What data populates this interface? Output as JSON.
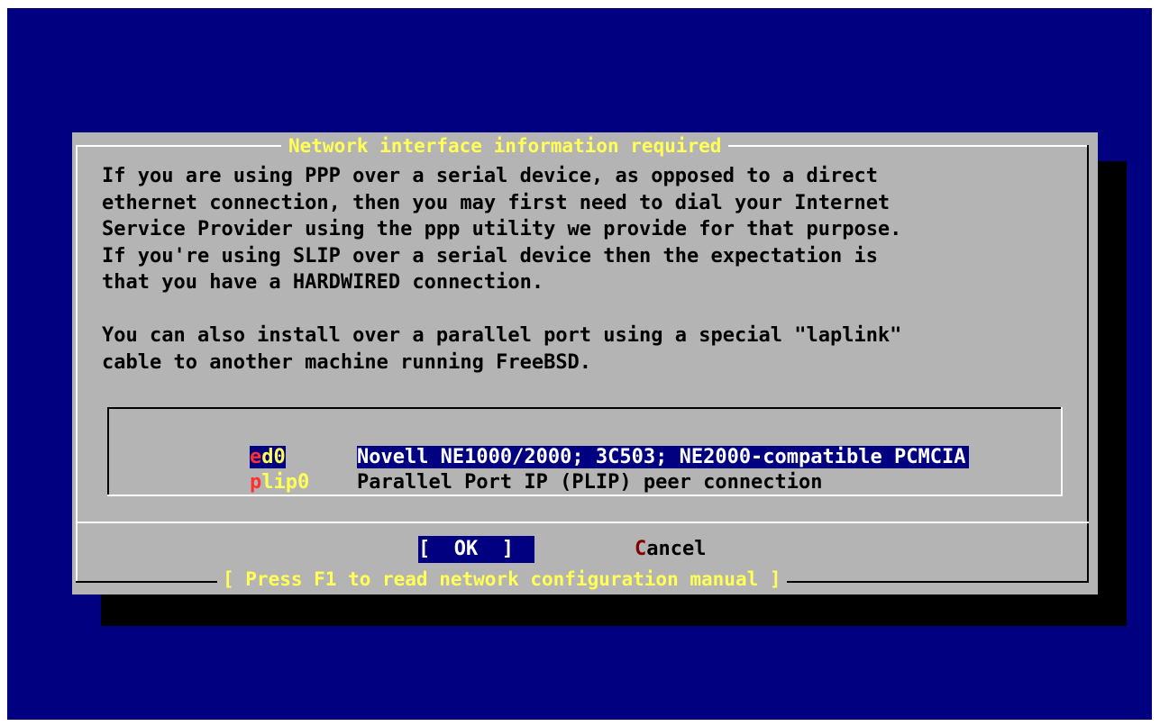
{
  "dialog": {
    "title": "Network interface information required",
    "body": "If you are using PPP over a serial device, as opposed to a direct\nethernet connection, then you may first need to dial your Internet\nService Provider using the ppp utility we provide for that purpose.\nIf you're using SLIP over a serial device then the expectation is\nthat you have a HARDWIRED connection.\n\nYou can also install over a parallel port using a special \"laplink\"\ncable to another machine running FreeBSD.",
    "interfaces": [
      {
        "hot": "e",
        "tag_rest": "d0",
        "description": "Novell NE1000/2000; 3C503; NE2000-compatible PCMCIA",
        "selected": true
      },
      {
        "hot": "p",
        "tag_rest": "lip0",
        "description": "Parallel Port IP (PLIP) peer connection",
        "selected": false
      }
    ],
    "buttons": {
      "ok": "[  OK  ]",
      "cancel_hot": "C",
      "cancel_rest": "ancel"
    },
    "footer_hint": "[ Press F1 to read network configuration manual ]"
  },
  "colors": {
    "background": "#000080",
    "dialog": "#b4b4b4",
    "title": "#ffff55",
    "hotkey": "#ff3030",
    "selection": "#000080"
  }
}
